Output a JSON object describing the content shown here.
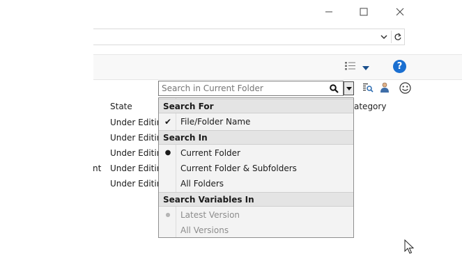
{
  "window": {
    "minimize_icon": "minimize-icon",
    "maximize_icon": "maximize-icon",
    "close_icon": "close-icon"
  },
  "address_bar": {
    "dropdown_icon": "chevron-down-icon",
    "refresh_icon": "refresh-icon"
  },
  "toolbar": {
    "view_icon": "details-view-icon",
    "help_icon": "help-icon",
    "accent": "#1a6fd1"
  },
  "search": {
    "placeholder": "Search in Current Folder",
    "icons": [
      "search-icon",
      "search-dropdown-icon",
      "advanced-search-icon",
      "user-icon",
      "smiley-icon"
    ]
  },
  "table": {
    "columns": [
      "State",
      "ategory"
    ],
    "left_fragment": "nt",
    "rows": [
      "Under Editir",
      "Under Editir",
      "Under Editir",
      "Under Editir",
      "Under Editir"
    ]
  },
  "menu": {
    "sections": [
      {
        "header": "Search For",
        "items": [
          {
            "label": "File/Folder Name",
            "mark": "✔",
            "enabled": true
          }
        ]
      },
      {
        "header": "Search In",
        "items": [
          {
            "label": "Current Folder",
            "mark": "●",
            "enabled": true
          },
          {
            "label": "Current Folder & Subfolders",
            "mark": "",
            "enabled": true
          },
          {
            "label": "All Folders",
            "mark": "",
            "enabled": true
          }
        ]
      },
      {
        "header": "Search Variables In",
        "items": [
          {
            "label": "Latest Version",
            "mark": "●",
            "enabled": false
          },
          {
            "label": "All Versions",
            "mark": "",
            "enabled": false
          }
        ]
      }
    ]
  }
}
